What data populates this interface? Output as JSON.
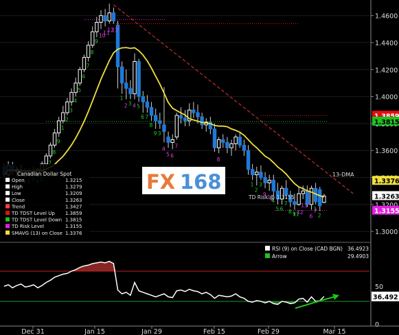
{
  "chart_data": [
    {
      "type": "candlestick",
      "title": "Canadian Dollar Spot",
      "ylim": [
        1.296,
        1.469
      ],
      "y_ticks": [
        "1.3000",
        "1.3200",
        "1.3400",
        "1.3600",
        "1.3800",
        "1.4000",
        "1.4200",
        "1.4400",
        "1.4600"
      ],
      "x_ticks": [
        "Dec 31",
        "Jan 15",
        "Jan 29",
        "Feb 15",
        "Feb 29",
        "Mar 15"
      ],
      "ohlc": [
        [
          1.3475,
          1.35,
          1.338,
          1.342
        ],
        [
          1.342,
          1.352,
          1.339,
          1.349
        ],
        [
          1.349,
          1.3515,
          1.342,
          1.3445
        ],
        [
          1.3445,
          1.348,
          1.341,
          1.346
        ],
        [
          1.346,
          1.3495,
          1.343,
          1.344
        ],
        [
          1.344,
          1.347,
          1.34,
          1.343
        ],
        [
          1.343,
          1.347,
          1.3405,
          1.345
        ],
        [
          1.345,
          1.348,
          1.342,
          1.343
        ],
        [
          1.343,
          1.347,
          1.34,
          1.346
        ],
        [
          1.345,
          1.352,
          1.342,
          1.35
        ],
        [
          1.35,
          1.358,
          1.347,
          1.356
        ],
        [
          1.356,
          1.366,
          1.354,
          1.364
        ],
        [
          1.364,
          1.376,
          1.362,
          1.373
        ],
        [
          1.373,
          1.385,
          1.37,
          1.382
        ],
        [
          1.382,
          1.393,
          1.38,
          1.388
        ],
        [
          1.388,
          1.399,
          1.386,
          1.396
        ],
        [
          1.396,
          1.406,
          1.393,
          1.403
        ],
        [
          1.403,
          1.414,
          1.4,
          1.41
        ],
        [
          1.41,
          1.422,
          1.408,
          1.42
        ],
        [
          1.42,
          1.431,
          1.418,
          1.429
        ],
        [
          1.429,
          1.441,
          1.426,
          1.438
        ],
        [
          1.438,
          1.452,
          1.436,
          1.448
        ],
        [
          1.448,
          1.459,
          1.444,
          1.455
        ],
        [
          1.455,
          1.464,
          1.45,
          1.46
        ],
        [
          1.46,
          1.465,
          1.452,
          1.456
        ],
        [
          1.456,
          1.4689,
          1.454,
          1.462
        ],
        [
          1.462,
          1.466,
          1.454,
          1.456
        ],
        [
          1.453,
          1.456,
          1.406,
          1.422
        ],
        [
          1.422,
          1.426,
          1.402,
          1.41
        ],
        [
          1.41,
          1.42,
          1.398,
          1.406
        ],
        [
          1.406,
          1.412,
          1.398,
          1.402
        ],
        [
          1.402,
          1.432,
          1.398,
          1.426
        ],
        [
          1.426,
          1.428,
          1.396,
          1.4
        ],
        [
          1.4,
          1.404,
          1.388,
          1.396
        ],
        [
          1.396,
          1.401,
          1.388,
          1.392
        ],
        [
          1.392,
          1.396,
          1.382,
          1.386
        ],
        [
          1.386,
          1.391,
          1.376,
          1.382
        ],
        [
          1.382,
          1.388,
          1.376,
          1.38
        ],
        [
          1.379,
          1.407,
          1.366,
          1.374
        ],
        [
          1.37,
          1.374,
          1.362,
          1.366
        ],
        [
          1.366,
          1.372,
          1.361,
          1.368
        ],
        [
          1.37,
          1.388,
          1.368,
          1.386
        ],
        [
          1.386,
          1.392,
          1.38,
          1.384
        ],
        [
          1.384,
          1.39,
          1.378,
          1.382
        ],
        [
          1.382,
          1.395,
          1.378,
          1.39
        ],
        [
          1.39,
          1.396,
          1.384,
          1.388
        ],
        [
          1.388,
          1.394,
          1.38,
          1.385
        ],
        [
          1.385,
          1.388,
          1.376,
          1.379
        ],
        [
          1.379,
          1.384,
          1.374,
          1.381
        ],
        [
          1.381,
          1.385,
          1.372,
          1.376
        ],
        [
          1.376,
          1.38,
          1.359,
          1.362
        ],
        [
          1.362,
          1.37,
          1.358,
          1.368
        ],
        [
          1.368,
          1.372,
          1.362,
          1.366
        ],
        [
          1.366,
          1.37,
          1.358,
          1.362
        ],
        [
          1.362,
          1.368,
          1.356,
          1.365
        ],
        [
          1.365,
          1.372,
          1.36,
          1.37
        ],
        [
          1.37,
          1.374,
          1.362,
          1.364
        ],
        [
          1.364,
          1.368,
          1.356,
          1.36
        ],
        [
          1.36,
          1.364,
          1.342,
          1.346
        ],
        [
          1.346,
          1.35,
          1.338,
          1.342
        ],
        [
          1.342,
          1.348,
          1.334,
          1.344
        ],
        [
          1.344,
          1.349,
          1.338,
          1.34
        ],
        [
          1.34,
          1.344,
          1.332,
          1.336
        ],
        [
          1.336,
          1.342,
          1.33,
          1.338
        ],
        [
          1.338,
          1.342,
          1.326,
          1.33
        ],
        [
          1.33,
          1.336,
          1.32,
          1.324
        ],
        [
          1.324,
          1.334,
          1.32,
          1.332
        ],
        [
          1.332,
          1.338,
          1.324,
          1.327
        ],
        [
          1.327,
          1.33,
          1.318,
          1.322
        ],
        [
          1.322,
          1.328,
          1.316,
          1.32
        ],
        [
          1.32,
          1.333,
          1.319,
          1.328
        ],
        [
          1.328,
          1.334,
          1.324,
          1.33
        ],
        [
          1.33,
          1.334,
          1.318,
          1.32
        ],
        [
          1.32,
          1.334,
          1.316,
          1.332
        ],
        [
          1.332,
          1.336,
          1.32,
          1.322
        ],
        [
          1.331,
          1.333,
          1.315,
          1.319
        ],
        [
          1.3215,
          1.3279,
          1.3209,
          1.3263
        ]
      ],
      "td_counts": [
        {
          "i": 5,
          "n": "1",
          "c": "green"
        },
        {
          "i": 6,
          "n": "2",
          "c": "green"
        },
        {
          "i": 7,
          "n": "3",
          "c": "green"
        },
        {
          "i": 8,
          "n": "4",
          "c": "green"
        },
        {
          "i": 9,
          "n": "5",
          "c": "green"
        },
        {
          "i": 10,
          "n": "6",
          "c": "green"
        },
        {
          "i": 11,
          "n": "7",
          "c": "green"
        },
        {
          "i": 12,
          "n": "8",
          "c": "green"
        },
        {
          "i": 13,
          "n": "9",
          "c": "green"
        },
        {
          "i": 14,
          "n": "1",
          "c": "green"
        },
        {
          "i": 15,
          "n": "2",
          "c": "green"
        },
        {
          "i": 16,
          "n": "3",
          "c": "green"
        },
        {
          "i": 17,
          "n": "4",
          "c": "green"
        },
        {
          "i": 18,
          "n": "5",
          "c": "green"
        },
        {
          "i": 19,
          "n": "6",
          "c": "green"
        },
        {
          "i": 20,
          "n": "7",
          "c": "green"
        },
        {
          "i": 21,
          "n": "8",
          "c": "green"
        },
        {
          "i": 22,
          "n": "9",
          "c": "green"
        },
        {
          "i": 23,
          "n": "10",
          "c": "magenta"
        },
        {
          "i": 24,
          "n": "11",
          "c": "magenta"
        },
        {
          "i": 25,
          "n": "12",
          "c": "magenta"
        },
        {
          "i": 26,
          "n": "13",
          "c": "magenta"
        },
        {
          "i": 28,
          "n": "1",
          "c": "green"
        },
        {
          "i": 29,
          "n": "2",
          "c": "magenta"
        },
        {
          "i": 30,
          "n": "3",
          "c": "green"
        },
        {
          "i": 31,
          "n": "4",
          "c": "magenta"
        },
        {
          "i": 32,
          "n": "5",
          "c": "green"
        },
        {
          "i": 33,
          "n": "6",
          "c": "green"
        },
        {
          "i": 34,
          "n": "7",
          "c": "green"
        },
        {
          "i": 35,
          "n": "8",
          "c": "green"
        },
        {
          "i": 36,
          "n": "9",
          "c": "green"
        },
        {
          "i": 37,
          "n": "3",
          "c": "green"
        },
        {
          "i": 38,
          "n": "4",
          "c": "magenta"
        },
        {
          "i": 39,
          "n": "5",
          "c": "magenta"
        },
        {
          "i": 40,
          "n": "6",
          "c": "magenta"
        },
        {
          "i": 41,
          "n": "7",
          "c": "magenta"
        },
        {
          "i": 51,
          "n": "8",
          "c": "magenta"
        },
        {
          "i": 59,
          "n": "1",
          "c": "green"
        },
        {
          "i": 60,
          "n": "2",
          "c": "green"
        },
        {
          "i": 61,
          "n": "3",
          "c": "green"
        },
        {
          "i": 62,
          "n": "9",
          "c": "magenta"
        },
        {
          "i": 63,
          "n": "10",
          "c": "magenta"
        },
        {
          "i": 64,
          "n": "4",
          "c": "green"
        },
        {
          "i": 65,
          "n": "5",
          "c": "green"
        },
        {
          "i": 66,
          "n": "6",
          "c": "green"
        },
        {
          "i": 67,
          "n": "7",
          "c": "green"
        },
        {
          "i": 68,
          "n": "8",
          "c": "green"
        },
        {
          "i": 69,
          "n": "9",
          "c": "green"
        },
        {
          "i": 69,
          "n": "11",
          "c": "green"
        },
        {
          "i": 70,
          "n": "12",
          "c": "magenta"
        },
        {
          "i": 71,
          "n": "13",
          "c": "magenta"
        },
        {
          "i": 73,
          "n": "6",
          "c": "magenta"
        },
        {
          "i": 74,
          "n": "1",
          "c": "green"
        },
        {
          "i": 75,
          "n": "2",
          "c": "green"
        },
        {
          "i": 74,
          "n": "7",
          "c": "magenta"
        }
      ],
      "levels": {
        "tdst_up": 1.3859,
        "tdst_down": 1.3815,
        "td_risk": 1.3155,
        "high_line": 1.457,
        "upper_dotted": 1.454
      },
      "trendline": {
        "from_bar": 26,
        "from_price": 1.468,
        "to_bar": 78,
        "to_price": 1.324
      },
      "trend_label": "13-DMA",
      "td_risk_label": "TD Risk @ 1.3155",
      "legend": {
        "title": "Canadian Dollar Spot",
        "rows": [
          {
            "label": "Open",
            "value": "1.3215",
            "color": "#ffffff"
          },
          {
            "label": "High",
            "value": "1.3279",
            "color": "#ffffff"
          },
          {
            "label": "Low",
            "value": "1.3209",
            "color": "#ffffff"
          },
          {
            "label": "Close",
            "value": "1.3263",
            "color": "#ffffff"
          },
          {
            "label": "Trend",
            "value": "1.3427",
            "color": "#ff4040"
          },
          {
            "label": "TD TDST Level Up",
            "value": "1.3859",
            "color": "#e01010"
          },
          {
            "label": "TD TDST Level Down",
            "value": "1.3815",
            "color": "#20c020"
          },
          {
            "label": "TD Risk Level",
            "value": "1.3155",
            "color": "#e020e0"
          },
          {
            "label": "SMAVG (13) on Close",
            "value": "1.3376",
            "color": "#f0e040"
          }
        ]
      },
      "price_tags": [
        {
          "value": "1.3859",
          "bg": "#e01010",
          "fg": "#ffffff"
        },
        {
          "value": "1.3815",
          "bg": "#20c020",
          "fg": "#000000"
        },
        {
          "value": "1.3376",
          "bg": "#f0e040",
          "fg": "#000000"
        },
        {
          "value": "1.3263",
          "bg": "#ffffff",
          "fg": "#000000"
        },
        {
          "value": "1.3155",
          "bg": "#e020e0",
          "fg": "#ffffff"
        }
      ]
    },
    {
      "type": "line",
      "title": "RSI (9) on Close (CAD BGN)",
      "ylim": [
        0,
        100
      ],
      "y_ticks": [
        "0",
        "50"
      ],
      "levels": {
        "upper": 70,
        "lower": 30
      },
      "series": [
        {
          "name": "RSI (9) on Close (CAD BGN)",
          "value_label": "36.4923",
          "color": "#ffffff",
          "values": [
            50,
            52,
            48,
            51,
            53,
            49,
            50,
            52,
            48,
            51,
            55,
            58,
            62,
            64,
            66,
            67,
            70,
            72,
            75,
            77,
            78,
            80,
            81,
            82,
            81,
            83,
            80,
            45,
            40,
            42,
            38,
            55,
            44,
            42,
            40,
            38,
            36,
            38,
            40,
            36,
            35,
            44,
            45,
            43,
            46,
            44,
            43,
            40,
            42,
            39,
            34,
            38,
            37,
            36,
            37,
            40,
            36,
            34,
            30,
            29,
            31,
            30,
            28,
            30,
            27,
            26,
            30,
            29,
            27,
            28,
            33,
            34,
            29,
            36,
            30,
            31,
            36.5
          ]
        },
        {
          "name": "Arrow",
          "value_label": "29.4903",
          "color": "#20c020"
        }
      ],
      "x_ticks": [
        "Dec 31",
        "Jan 15",
        "Jan 29",
        "Feb 15",
        "Feb 29",
        "Mar 15"
      ]
    }
  ],
  "watermark": {
    "part1": "FX",
    "part2": "168"
  },
  "colors": {
    "background": "#000000",
    "up_candle": "#ffffff",
    "down_candle": "#1e7ad8",
    "sma": "#f0e040",
    "trend": "#c03030"
  }
}
